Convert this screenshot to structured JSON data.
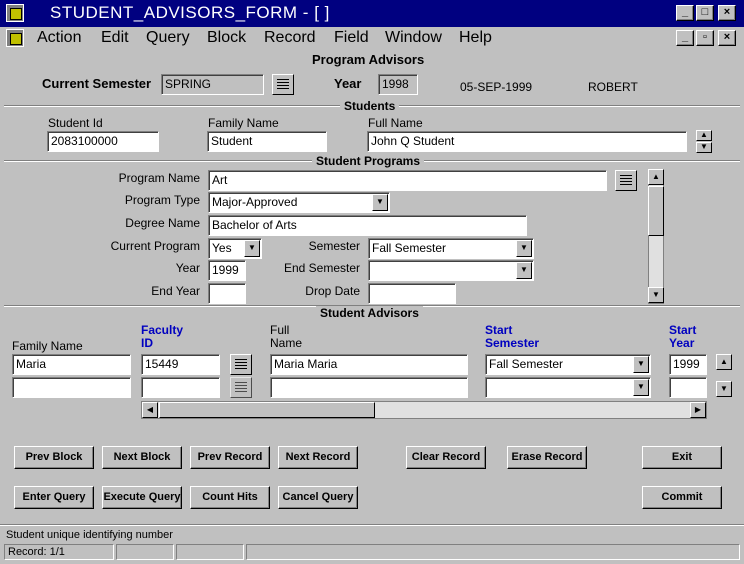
{
  "window": {
    "title": "STUDENT_ADVISORS_FORM - [ ]"
  },
  "menu": [
    "Action",
    "Edit",
    "Query",
    "Block",
    "Record",
    "Field",
    "Window",
    "Help"
  ],
  "header": {
    "form_title": "Program Advisors",
    "current_semester_label": "Current Semester",
    "current_semester_value": "SPRING",
    "year_label": "Year",
    "year_value": "1998",
    "date": "05-SEP-1999",
    "user": "ROBERT"
  },
  "students": {
    "title": "Students",
    "student_id_label": "Student Id",
    "student_id_value": "2083100000",
    "family_name_label": "Family Name",
    "family_name_value": "Student",
    "full_name_label": "Full Name",
    "full_name_value": "John Q Student"
  },
  "programs": {
    "title": "Student Programs",
    "program_name_label": "Program Name",
    "program_name_value": "Art",
    "program_type_label": "Program Type",
    "program_type_value": "Major-Approved",
    "degree_name_label": "Degree Name",
    "degree_name_value": "Bachelor of Arts",
    "current_program_label": "Current Program",
    "current_program_value": "Yes",
    "semester_label": "Semester",
    "semester_value": "Fall Semester",
    "year_label": "Year",
    "year_value": "1999",
    "end_semester_label": "End Semester",
    "end_semester_value": "",
    "end_year_label": "End Year",
    "end_year_value": "",
    "drop_date_label": "Drop Date",
    "drop_date_value": ""
  },
  "advisors": {
    "title": "Student Advisors",
    "col_family_name": "Family Name",
    "col_faculty_id_1": "Faculty",
    "col_faculty_id_2": "ID",
    "col_full_name_1": "Full",
    "col_full_name_2": "Name",
    "col_start_semester_1": "Start",
    "col_start_semester_2": "Semester",
    "col_start_year_1": "Start",
    "col_start_year_2": "Year",
    "rows": [
      {
        "family_name": "Maria",
        "faculty_id": "15449",
        "full_name": "Maria  Maria",
        "start_semester": "Fall Semester",
        "start_year": "1999"
      },
      {
        "family_name": "",
        "faculty_id": "",
        "full_name": "",
        "start_semester": "",
        "start_year": ""
      }
    ]
  },
  "buttons": {
    "prev_block": "Prev Block",
    "next_block": "Next Block",
    "prev_record": "Prev Record",
    "next_record": "Next Record",
    "clear_record": "Clear Record",
    "erase_record": "Erase Record",
    "exit": "Exit",
    "enter_query": "Enter Query",
    "execute_query": "Execute Query",
    "count_hits": "Count Hits",
    "cancel_query": "Cancel Query",
    "commit": "Commit"
  },
  "status": {
    "hint": "Student unique identifying number",
    "record": "Record: 1/1"
  }
}
